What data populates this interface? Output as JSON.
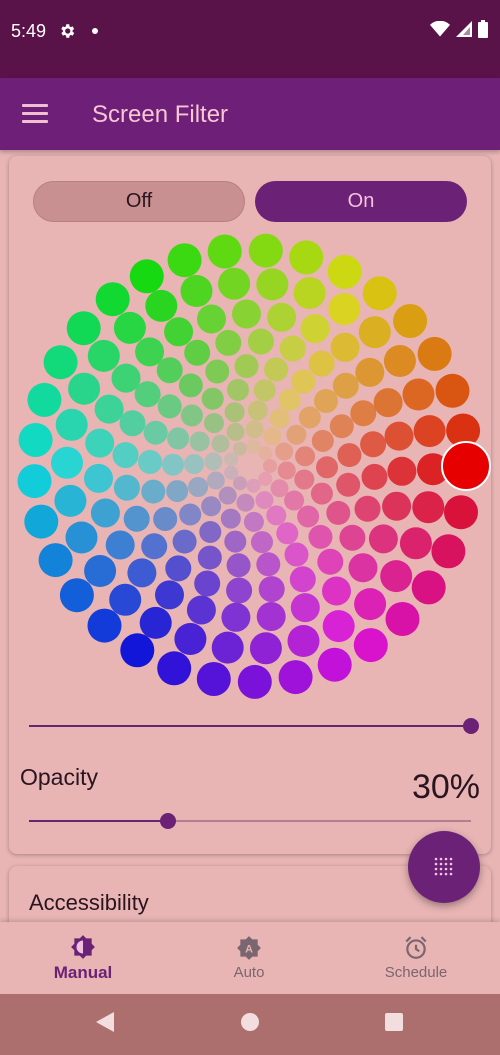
{
  "status_bar": {
    "time": "5:49"
  },
  "app_bar": {
    "title": "Screen Filter"
  },
  "toggle": {
    "off_label": "Off",
    "on_label": "On",
    "selected": "On"
  },
  "color_wheel": {
    "selected_color": "#e60000"
  },
  "intensity_slider": {
    "value": 1.0
  },
  "opacity": {
    "label": "Opacity",
    "value_text": "30%",
    "value": 0.3
  },
  "accessibility": {
    "title": "Accessibility"
  },
  "bottom_nav": {
    "items": [
      {
        "label": "Manual",
        "icon": "manual-brightness-icon",
        "active": true
      },
      {
        "label": "Auto",
        "icon": "auto-brightness-icon",
        "active": false
      },
      {
        "label": "Schedule",
        "icon": "alarm-clock-icon",
        "active": false
      }
    ]
  },
  "colors": {
    "accent": "#6b2276",
    "background": "#e8b4b4",
    "status_bar": "#5a1348",
    "app_bar": "#6e1f78"
  }
}
